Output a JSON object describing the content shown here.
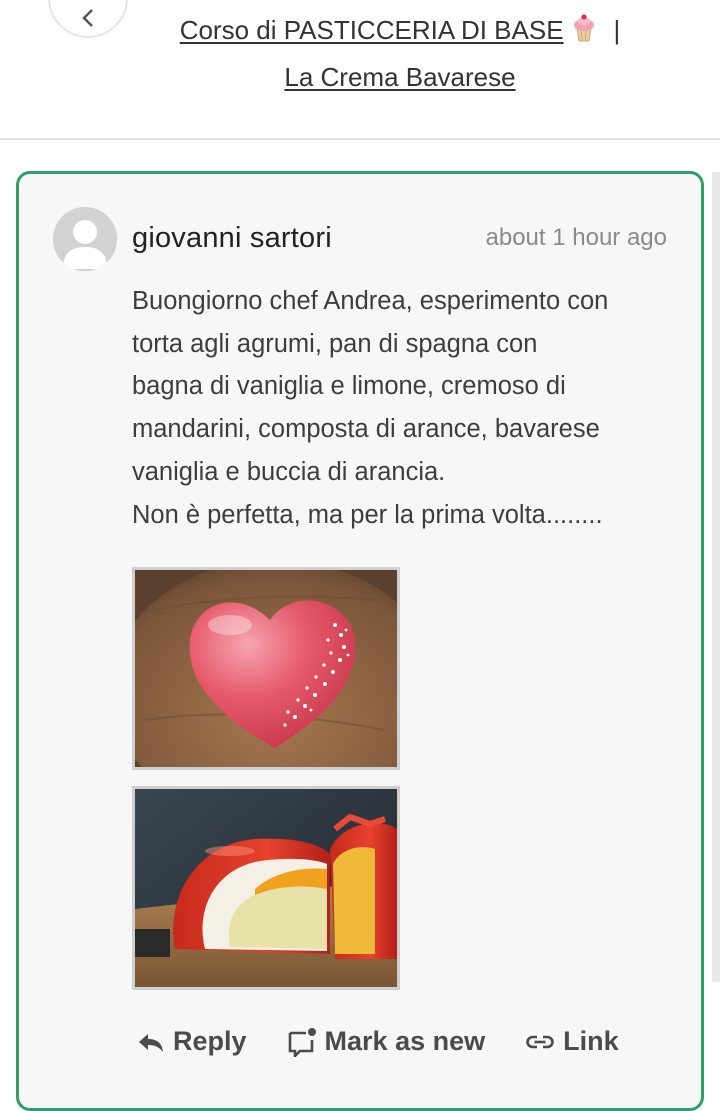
{
  "header": {
    "back_icon": "chevron-left-icon",
    "breadcrumb_course": "Corso di PASTICCERIA DI BASE",
    "course_emoji": "cupcake-icon",
    "separator": "|",
    "breadcrumb_lesson": "La Crema Bavarese"
  },
  "comment": {
    "author": "giovanni sartori",
    "timestamp": "about 1 hour ago",
    "body_lines": [
      "Buongiorno chef Andrea, esperimento con",
      "torta agli agrumi, pan di spagna con",
      "bagna di vaniglia e limone, cremoso di",
      "mandarini, composta di arance, bavarese",
      "vaniglia e buccia di arancia.",
      "Non è perfetta, ma per la prima volta........"
    ],
    "photos": [
      "heart-cake-photo",
      "sliced-cake-photo"
    ],
    "actions": {
      "reply": "Reply",
      "mark_as_new": "Mark as new",
      "link": "Link"
    }
  },
  "colors": {
    "accent_border": "#2f9e6a",
    "card_bg": "#f7f7f7",
    "text": "#3d3d3d",
    "muted": "#8a8a8a"
  }
}
